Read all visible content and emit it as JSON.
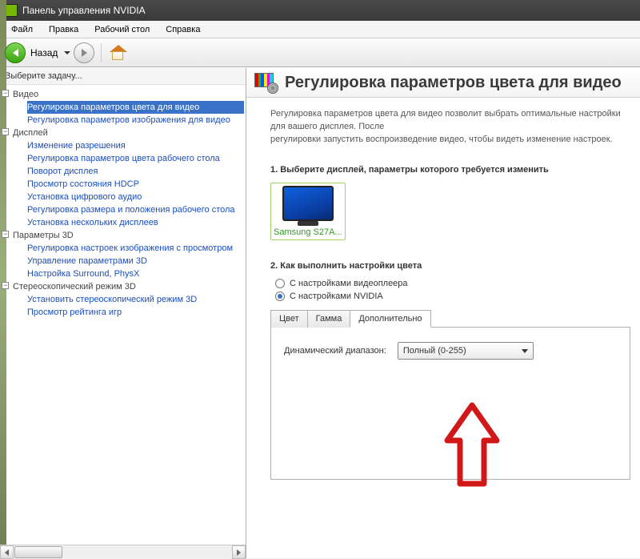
{
  "titlebar": {
    "title": "Панель управления NVIDIA"
  },
  "menubar": {
    "file": "Файл",
    "edit": "Правка",
    "desktop": "Рабочий стол",
    "help": "Справка"
  },
  "toolbar": {
    "back_label": "Назад"
  },
  "sidebar": {
    "heading": "Выберите задачу...",
    "cat_video": "Видео",
    "video_items": [
      "Регулировка параметров цвета для видео",
      "Регулировка параметров изображения для видео"
    ],
    "cat_display": "Дисплей",
    "display_items": [
      "Изменение разрешения",
      "Регулировка параметров цвета рабочего стола",
      "Поворот дисплея",
      "Просмотр состояния HDCP",
      "Установка цифрового аудио",
      "Регулировка размера и положения рабочего стола",
      "Установка нескольких дисплеев"
    ],
    "cat_3d": "Параметры 3D",
    "d3d_items": [
      "Регулировка настроек изображения с просмотром",
      "Управление параметрами 3D",
      "Настройка Surround, PhysX"
    ],
    "cat_stereo": "Стереоскопический режим 3D",
    "stereo_items": [
      "Установить стереоскопический режим 3D",
      "Просмотр рейтинга игр"
    ]
  },
  "content": {
    "page_title": "Регулировка параметров цвета для видео",
    "description_line1": "Регулировка параметров цвета для видео позволит выбрать оптимальные настройки для вашего дисплея. После",
    "description_line2": "регулировки запустить воспроизведение видео, чтобы видеть изменение настроек.",
    "step1_label": "1. Выберите дисплей, параметры которого требуется изменить",
    "display_name": "Samsung S27A...",
    "step2_label": "2. Как выполнить настройки цвета",
    "radio_player": "С настройками видеоплеера",
    "radio_nvidia": "С настройками NVIDIA",
    "tabs": {
      "color": "Цвет",
      "gamma": "Гамма",
      "advanced": "Дополнительно"
    },
    "range_label": "Динамический диапазон:",
    "range_value": "Полный (0-255)"
  }
}
